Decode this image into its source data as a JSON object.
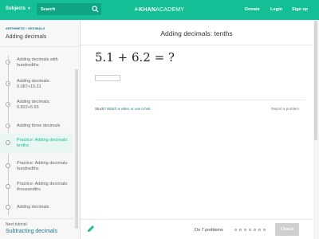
{
  "header": {
    "subjects_label": "Subjects",
    "search_label": "Search",
    "logo_prefix": "✳",
    "logo_bold": "KHAN",
    "logo_rest": "ACADEMY",
    "donate": "Donate",
    "login": "Login",
    "signup": "Sign up",
    "color": "#14bf96"
  },
  "sidebar": {
    "breadcrumb": "ARITHMETIC › DECIMALS",
    "title": "Adding decimals",
    "items": [
      {
        "label": "Adding decimals with hundredths",
        "icon": "play-icon"
      },
      {
        "label": "Adding decimals: 9.087+15.31",
        "icon": "play-icon"
      },
      {
        "label": "Adding decimals: 0.822+5.65",
        "icon": "play-icon"
      },
      {
        "label": "Adding three decimals",
        "icon": "play-icon"
      },
      {
        "label": "Practice: Adding decimals: tenths",
        "icon": "star-icon",
        "active": true
      },
      {
        "label": "Practice: Adding decimals: hundredths",
        "icon": "star-icon"
      },
      {
        "label": "Practice: Adding decimals: thousandths",
        "icon": "star-icon"
      },
      {
        "label": "Adding decimals",
        "icon": "star-icon"
      }
    ],
    "next_label": "Next tutorial",
    "next_link": "Subtracting decimals"
  },
  "exercise": {
    "title": "Adding decimals: tenths",
    "problem": "5.1 + 6.2 = ?",
    "stuck_label": "Stuck?",
    "hint_link": "Watch a video or use a hint.",
    "report": "Report a problem",
    "progress_text": "Do 7 problems",
    "check_label": "Check"
  }
}
